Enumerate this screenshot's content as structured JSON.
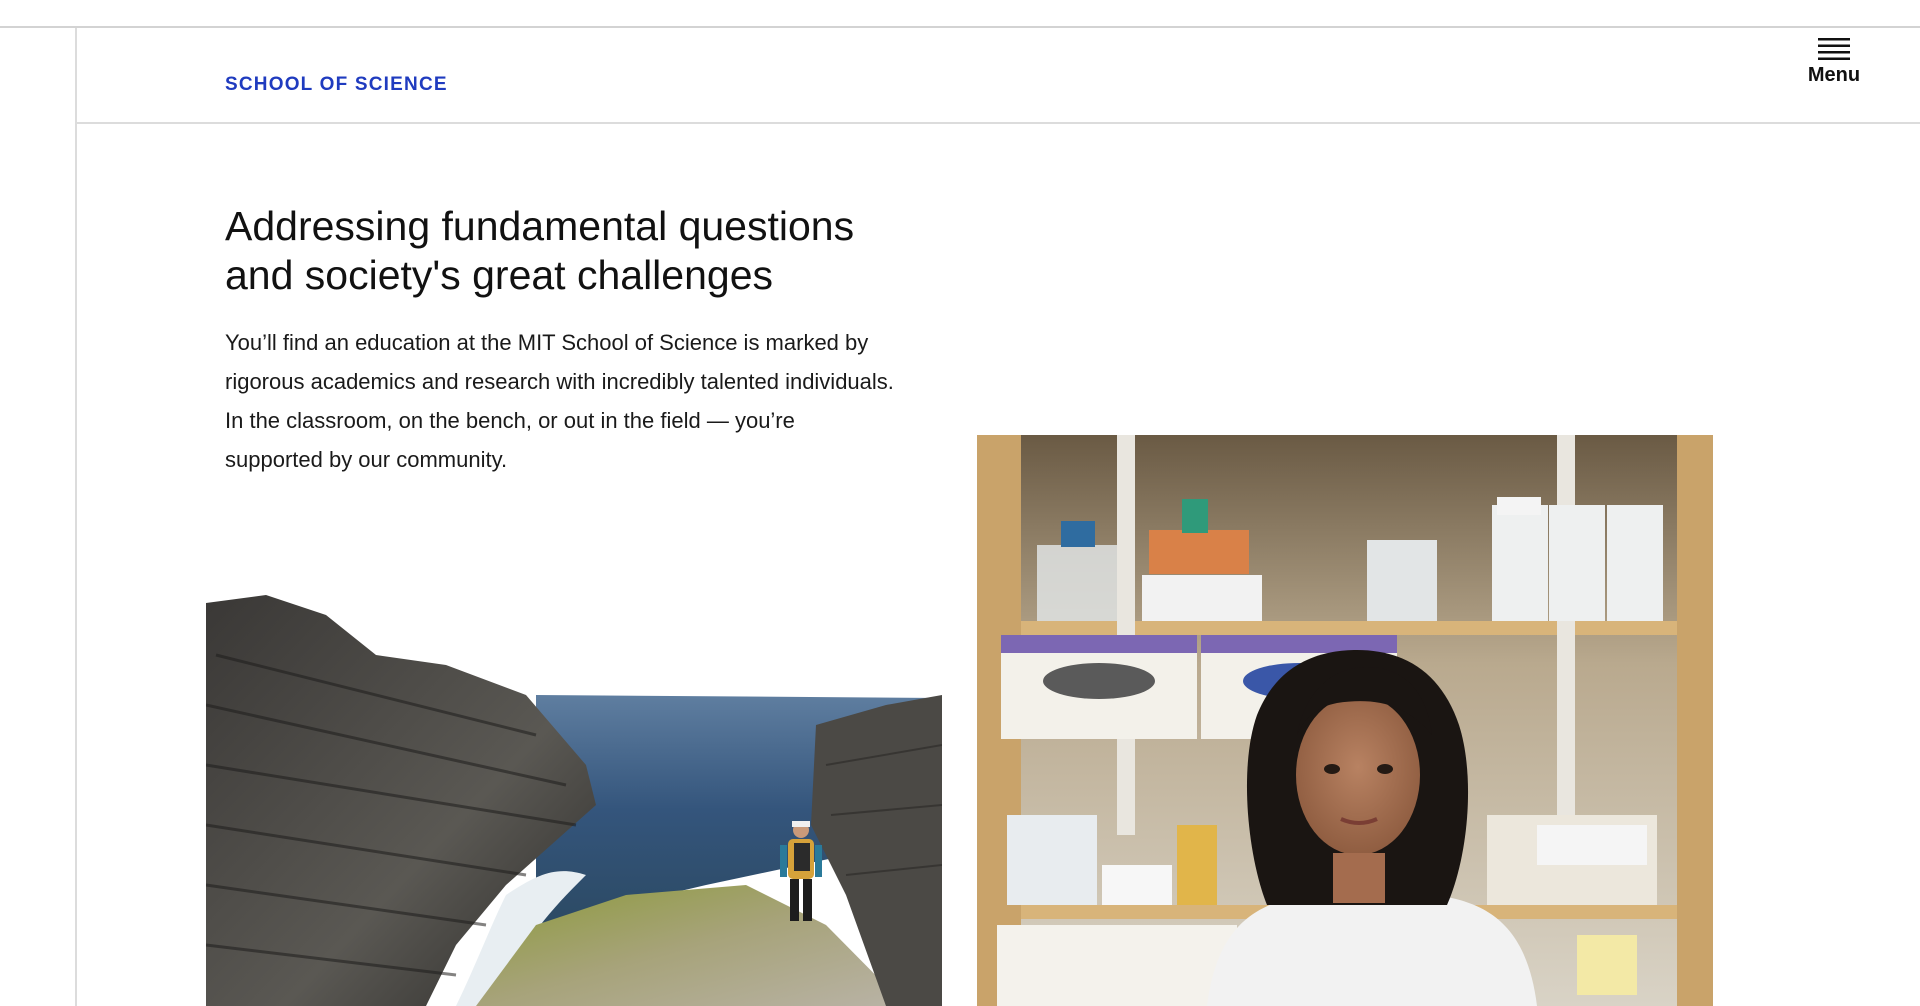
{
  "header": {
    "brand": "SCHOOL OF SCIENCE",
    "menu_label": "Menu",
    "menu_icon": "hamburger-icon",
    "brand_color": "#1f3bbf"
  },
  "hero": {
    "headline_line1": "Addressing fundamental questions",
    "headline_line2": "and society's great challenges",
    "intro_line1": "You’ll find an education at the MIT School of Science is marked by",
    "intro_line2": "rigorous academics and research with incredibly talented individuals.",
    "intro_line3": "In the classroom, on the bench, or out in the field — you’re",
    "intro_line4": "supported by our community."
  },
  "images": {
    "coast": "photo of a hiker walking on a rocky coastline by the sea",
    "lab": "photo of a researcher standing in front of laboratory shelves"
  }
}
